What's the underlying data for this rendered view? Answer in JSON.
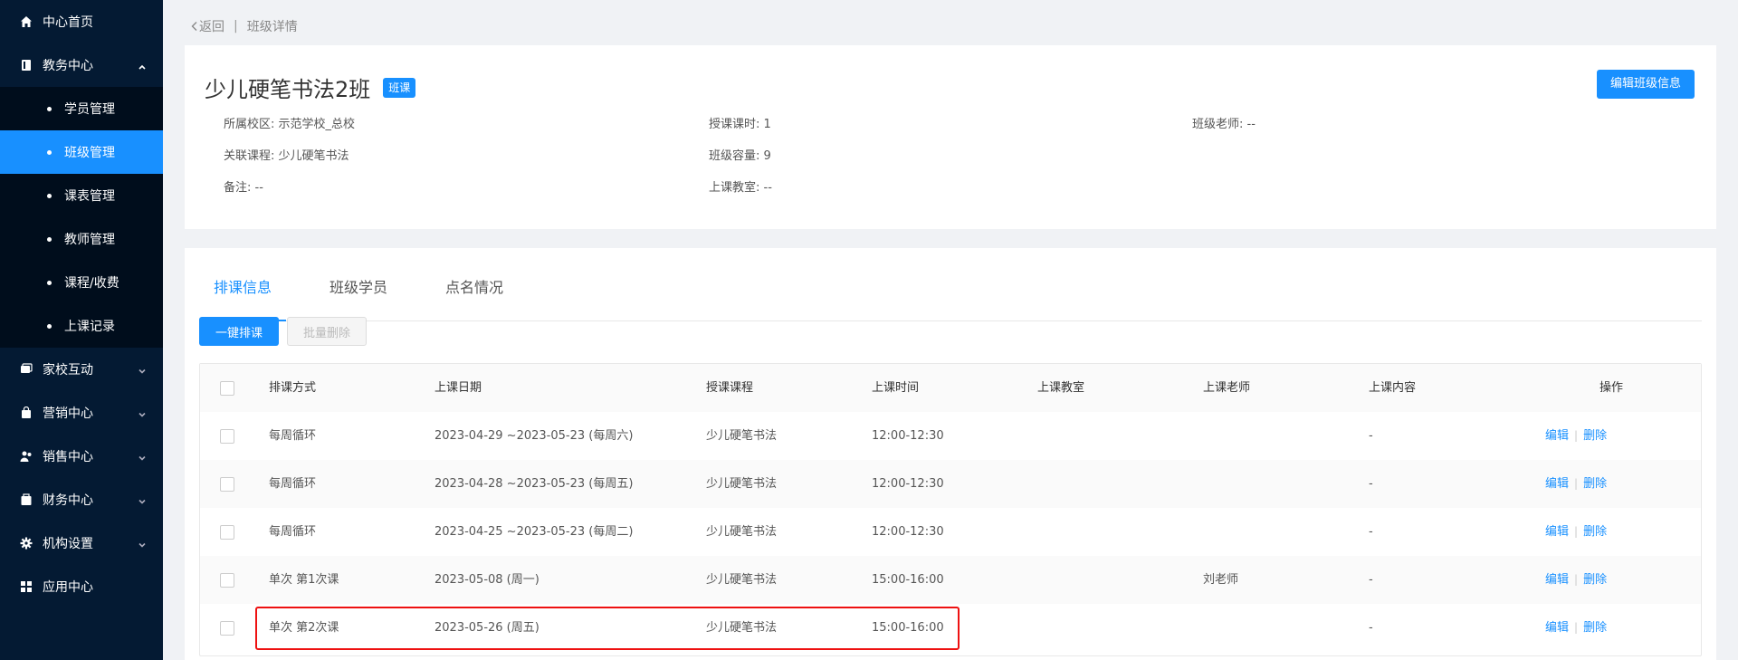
{
  "sidebar": {
    "items": [
      {
        "label": "中心首页",
        "icon": "home-icon"
      },
      {
        "label": "教务中心",
        "icon": "book-icon"
      },
      {
        "label": "家校互动",
        "icon": "chat-icon"
      },
      {
        "label": "营销中心",
        "icon": "bag-icon"
      },
      {
        "label": "销售中心",
        "icon": "user-group-icon"
      },
      {
        "label": "财务中心",
        "icon": "wallet-icon"
      },
      {
        "label": "机构设置",
        "icon": "gear-icon"
      },
      {
        "label": "应用中心",
        "icon": "grid-icon"
      }
    ],
    "submenu": [
      "学员管理",
      "班级管理",
      "课表管理",
      "教师管理",
      "课程/收费",
      "上课记录"
    ],
    "active_sub": "班级管理"
  },
  "breadcrumb": {
    "back": "返回",
    "current": "班级详情"
  },
  "class_info": {
    "title": "少儿硬笔书法2班",
    "tag": "班课",
    "edit_button": "编辑班级信息",
    "campus": "所属校区: 示范学校_总校",
    "hours": "授课课时: 1",
    "teacher": "班级老师: --",
    "course": "关联课程: 少儿硬笔书法",
    "capacity": "班级容量: 9",
    "note": "备注: --",
    "classroom": "上课教室: --"
  },
  "tabs": [
    "排课信息",
    "班级学员",
    "点名情况"
  ],
  "actions": {
    "primary": "一键排课",
    "batch_delete": "批量删除"
  },
  "table": {
    "headers": [
      "排课方式",
      "上课日期",
      "授课课程",
      "上课时间",
      "上课教室",
      "上课老师",
      "上课内容",
      "操作"
    ],
    "rows": [
      [
        "每周循环",
        "2023-04-29 ~2023-05-23 (每周六)",
        "少儿硬笔书法",
        "12:00-12:30",
        "",
        "",
        "-"
      ],
      [
        "每周循环",
        "2023-04-28 ~2023-05-23 (每周五)",
        "少儿硬笔书法",
        "12:00-12:30",
        "",
        "",
        "-"
      ],
      [
        "每周循环",
        "2023-04-25 ~2023-05-23 (每周二)",
        "少儿硬笔书法",
        "12:00-12:30",
        "",
        "",
        "-"
      ],
      [
        "单次 第1次课",
        "2023-05-08 (周一)",
        "少儿硬笔书法",
        "15:00-16:00",
        "",
        "刘老师",
        "-"
      ],
      [
        "单次 第2次课",
        "2023-05-26 (周五)",
        "少儿硬笔书法",
        "15:00-16:00",
        "",
        "",
        "-"
      ]
    ],
    "op_edit": "编辑",
    "op_delete": "删除"
  },
  "colors": {
    "accent": "#1890ff",
    "sidebar": "#041a33",
    "highlight": "#e11111"
  }
}
